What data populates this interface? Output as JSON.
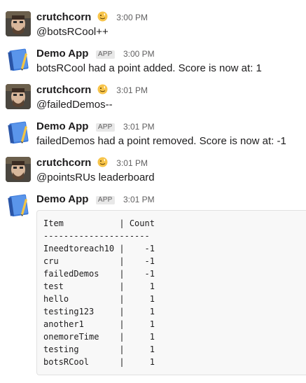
{
  "messages": [
    {
      "sender": "crutchcorn",
      "kind": "user",
      "time": "3:00 PM",
      "text": "@botsRCool++"
    },
    {
      "sender": "Demo App",
      "kind": "app",
      "badge": "APP",
      "time": "3:00 PM",
      "text": "botsRCool had a point added. Score is now at: 1"
    },
    {
      "sender": "crutchcorn",
      "kind": "user",
      "time": "3:01 PM",
      "text": "@failedDemos--"
    },
    {
      "sender": "Demo App",
      "kind": "app",
      "badge": "APP",
      "time": "3:01 PM",
      "text": "failedDemos had a point removed. Score is now at: -1"
    },
    {
      "sender": "crutchcorn",
      "kind": "user",
      "time": "3:01 PM",
      "text": "@pointsRUs leaderboard"
    },
    {
      "sender": "Demo App",
      "kind": "app",
      "badge": "APP",
      "time": "3:01 PM",
      "text": ""
    }
  ],
  "leaderboard": {
    "header": "Item           | Count",
    "divider": "---------------------",
    "rows": [
      "Ineedtoreach10 |    -1",
      "cru            |    -1",
      "failedDemos    |    -1",
      "test           |     1",
      "hello          |     1",
      "testing123     |     1",
      "another1       |     1",
      "onemoreTime    |     1",
      "testing        |     1",
      "botsRCool      |     1"
    ]
  },
  "icons": {
    "user_avatar": "person-avatar-icon",
    "app_avatar": "notebook-app-icon",
    "status": "status-emoji-icon"
  }
}
